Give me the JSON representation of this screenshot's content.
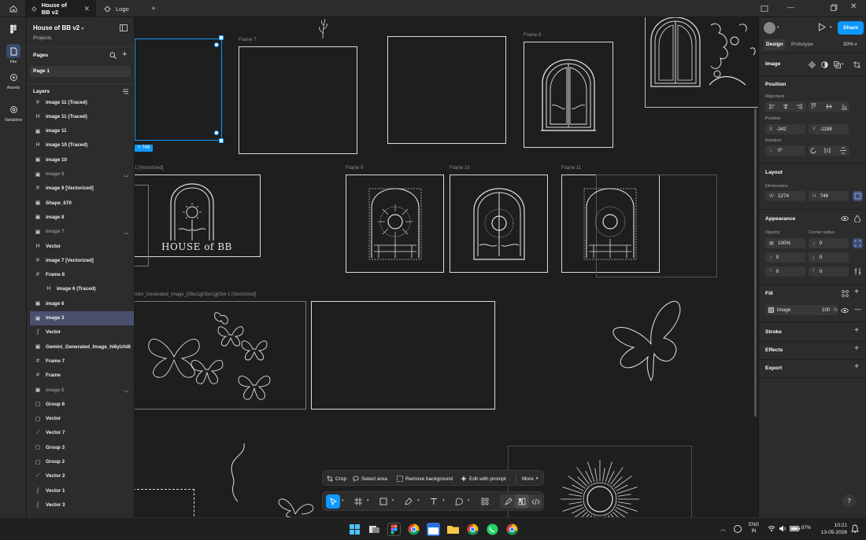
{
  "tabs": [
    {
      "label": "House of BB v2",
      "active": true
    },
    {
      "label": "Logo",
      "active": false
    }
  ],
  "rail": {
    "file": "File",
    "assets": "Assets",
    "variables": "Variables"
  },
  "file": {
    "name": "House of BB v2",
    "projects_link": "Projects"
  },
  "pages": {
    "header": "Pages",
    "items": [
      "Page 1"
    ]
  },
  "layers": {
    "header": "Layers",
    "items": [
      {
        "label": "image 11 (Traced)",
        "icon": "#",
        "dim": false,
        "hidden": false
      },
      {
        "label": "image 11 (Traced)",
        "icon": "H",
        "dim": false,
        "hidden": false
      },
      {
        "label": "image 11",
        "icon": "▣",
        "dim": false,
        "hidden": false
      },
      {
        "label": "image 10 (Traced)",
        "icon": "H",
        "dim": false,
        "hidden": false
      },
      {
        "label": "image 10",
        "icon": "▣",
        "dim": false,
        "hidden": false
      },
      {
        "label": "image 9",
        "icon": "▣",
        "dim": true,
        "hidden": true
      },
      {
        "label": "image 9 [Vectorized]",
        "icon": "#",
        "dim": false,
        "hidden": false
      },
      {
        "label": "Shape_670",
        "icon": "▣",
        "dim": false,
        "hidden": false
      },
      {
        "label": "image 8",
        "icon": "▣",
        "dim": false,
        "hidden": false
      },
      {
        "label": "image 7",
        "icon": "▣",
        "dim": true,
        "hidden": true
      },
      {
        "label": "Vector",
        "icon": "H",
        "dim": false,
        "hidden": false
      },
      {
        "label": "image 7 [Vectorized]",
        "icon": "#",
        "dim": false,
        "hidden": false
      },
      {
        "label": "Frame 8",
        "icon": "#",
        "dim": false,
        "hidden": false
      },
      {
        "label": "image 6 (Traced)",
        "icon": "H",
        "dim": false,
        "hidden": false,
        "indent": true
      },
      {
        "label": "image 6",
        "icon": "▣",
        "dim": false,
        "hidden": false
      },
      {
        "label": "image 3",
        "icon": "▣",
        "dim": false,
        "hidden": false,
        "selected": true
      },
      {
        "label": "Vector",
        "icon": "ʃ",
        "dim": false,
        "hidden": false
      },
      {
        "label": "Gemini_Generated_Image_hi8ylzhi8yl",
        "icon": "▣",
        "dim": false,
        "hidden": false
      },
      {
        "label": "Frame 7",
        "icon": "#",
        "dim": false,
        "hidden": false
      },
      {
        "label": "Frame",
        "icon": "#",
        "dim": false,
        "hidden": false
      },
      {
        "label": "image 5",
        "icon": "▣",
        "dim": true,
        "hidden": true
      },
      {
        "label": "Group 6",
        "icon": "▢",
        "dim": false,
        "hidden": false
      },
      {
        "label": "Vector",
        "icon": "▢",
        "dim": false,
        "hidden": false
      },
      {
        "label": "Vector 7",
        "icon": "⟋",
        "dim": false,
        "hidden": false
      },
      {
        "label": "Group 3",
        "icon": "▢",
        "dim": false,
        "hidden": false
      },
      {
        "label": "Group 2",
        "icon": "▢",
        "dim": false,
        "hidden": false
      },
      {
        "label": "Vector 2",
        "icon": "⟋",
        "dim": false,
        "hidden": false
      },
      {
        "label": "Vector 1",
        "icon": "ʃ",
        "dim": false,
        "hidden": false
      },
      {
        "label": "Vector 3",
        "icon": "ʃ",
        "dim": false,
        "hidden": false
      }
    ]
  },
  "canvas": {
    "frame_labels": {
      "f7": "Frame 7",
      "f8": "Frame 8",
      "f9": "Frame 9",
      "f10": "Frame 10",
      "f11": "Frame 11",
      "vectorized": "1 [Vectorized]",
      "gemini": "mini_Generated_Image_j05w1gj05w1gj05w 1 [Vectorized]"
    },
    "dimension_badge": "× 746",
    "logo_text": "HOUSE of BB"
  },
  "context_toolbar": {
    "crop": "Crop",
    "select_area": "Select area",
    "remove_background": "Remove background",
    "edit_with_prompt": "Edit with prompt",
    "more": "More"
  },
  "right": {
    "tabs": {
      "design": "Design",
      "prototype": "Prototype"
    },
    "zoom": "30%",
    "share": "Share",
    "selection_type": "Image",
    "position": {
      "header": "Position",
      "alignment_label": "Alignment",
      "position_label": "Position",
      "x_label": "X",
      "x": "-342",
      "y_label": "Y",
      "y": "-1188",
      "rotation_label": "Rotation",
      "rotation": "0°"
    },
    "layout": {
      "header": "Layout",
      "dimensions_label": "Dimensions",
      "w_label": "W",
      "w": "1274",
      "h_label": "H",
      "h": "746"
    },
    "appearance": {
      "header": "Appearance",
      "opacity_label": "Opacity",
      "opacity": "100%",
      "radius_label": "Corner radius",
      "radius": "0",
      "r1": "0",
      "r2": "0",
      "r3": "0",
      "r4": "0"
    },
    "fill": {
      "header": "Fill",
      "type": "Image",
      "opacity": "100",
      "unit": "%"
    },
    "stroke": {
      "header": "Stroke"
    },
    "effects": {
      "header": "Effects"
    },
    "export": {
      "header": "Export"
    }
  },
  "taskbar": {
    "lang_top": "ENG",
    "lang_bottom": "IN",
    "battery": "97%",
    "time": "10:21",
    "date": "13-05-2026"
  },
  "colors": {
    "accent": "#0d99ff",
    "selection": "#4a4f6e",
    "canvas": "#1e1e1e",
    "panel": "#2c2c2c"
  }
}
